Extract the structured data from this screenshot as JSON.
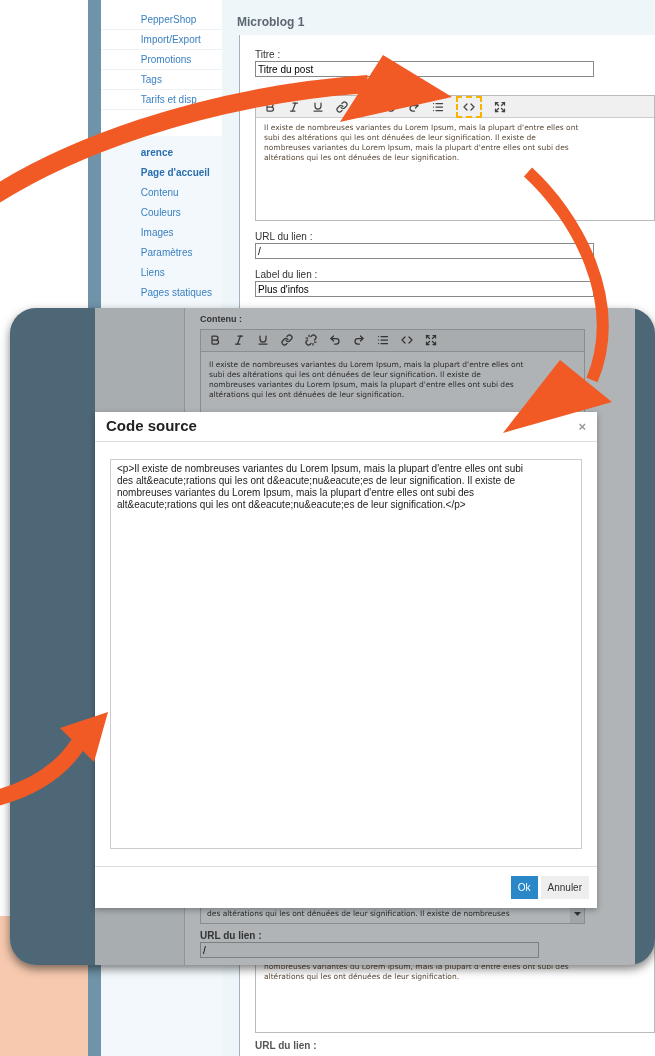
{
  "sidebar": {
    "items": [
      {
        "label": "PepperShop",
        "kind": "link"
      },
      {
        "label": "Import/Export",
        "kind": "link"
      },
      {
        "label": "Promotions",
        "kind": "link"
      },
      {
        "label": "Tags",
        "kind": "link"
      },
      {
        "label": "Tarifs et disp",
        "kind": "link"
      },
      {
        "label": "arence",
        "kind": "heading"
      },
      {
        "label": "Page d'accueil",
        "kind": "heading"
      },
      {
        "label": "Contenu",
        "kind": "sublink"
      },
      {
        "label": "Couleurs",
        "kind": "sublink"
      },
      {
        "label": "Images",
        "kind": "sublink"
      },
      {
        "label": "Paramètres",
        "kind": "sublink"
      },
      {
        "label": "Liens",
        "kind": "sublink"
      },
      {
        "label": "Pages statiques",
        "kind": "sublink"
      }
    ]
  },
  "form": {
    "title": "Microblog 1",
    "title_field": {
      "label": "Titre :",
      "value": "Titre du post"
    },
    "editor_lines": [
      "Il existe de nombreuses variantes du Lorem Ipsum, mais la plupart d'entre elles ont",
      "subi des altérations qui les ont dénuées de leur signification. Il existe de",
      "nombreuses variantes du Lorem Ipsum, mais la plupart d'entre elles ont subi des",
      "altérations qui les ont dénuées de leur signification."
    ],
    "url_field": {
      "label": "URL du lien :",
      "value": "/"
    },
    "link_label_field": {
      "label": "Label du lien :",
      "value": "Plus d'infos"
    }
  },
  "lower_form": {
    "editor_lines": [
      "nombreuses variantes du Lorem Ipsum, mais la plupart d'entre elles ont subi des",
      "altérations qui les ont dénuées de leur signification."
    ],
    "url_label": "URL du lien :"
  },
  "overlay": {
    "content_label": "Contenu :",
    "editor_lines": [
      "Il existe de nombreuses variantes du Lorem Ipsum, mais la plupart d'entre elles ont",
      "subi des altérations qui les ont dénuées de leur signification. Il existe de",
      "nombreuses variantes du Lorem Ipsum, mais la plupart d'entre elles ont subi des",
      "altérations qui les ont dénuées de leur signification."
    ],
    "dialog": {
      "title": "Code source",
      "close": "×",
      "code_lines": [
        "<p>Il existe de nombreuses variantes du Lorem Ipsum, mais la plupart d'entre elles ont subi",
        "des alt&eacute;rations qui les ont d&eacute;nu&eacute;es de leur signification. Il existe de",
        "nombreuses variantes du Lorem Ipsum, mais la plupart d'entre elles ont subi des",
        "alt&eacute;rations qui les ont d&eacute;nu&eacute;es de leur signification.</p>"
      ],
      "buttons": [
        {
          "label": "Ok",
          "kind": "primary"
        },
        {
          "label": "Annuler",
          "kind": "secondary"
        }
      ]
    },
    "editor_tail_line": "des altérations qui les ont dénuées de leur signification. Il existe de nombreuses",
    "url_field": {
      "label": "URL du lien :",
      "value": "/"
    }
  }
}
